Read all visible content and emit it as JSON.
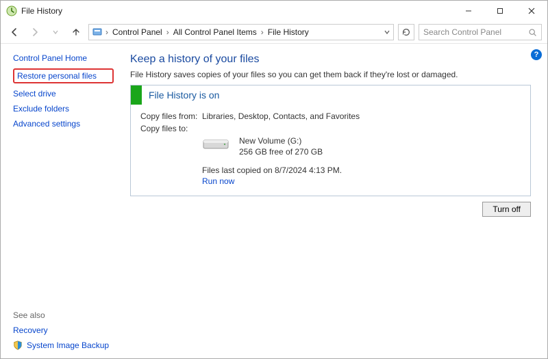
{
  "window": {
    "title": "File History"
  },
  "win_buttons": {
    "min": "—",
    "max": "▢",
    "close": "✕"
  },
  "breadcrumbs": [
    "Control Panel",
    "All Control Panel Items",
    "File History"
  ],
  "search": {
    "placeholder": "Search Control Panel"
  },
  "leftnav": {
    "home": "Control Panel Home",
    "restore": "Restore personal files",
    "select_drive": "Select drive",
    "exclude": "Exclude folders",
    "advanced": "Advanced settings"
  },
  "seealso": {
    "title": "See also",
    "recovery": "Recovery",
    "sib": "System Image Backup"
  },
  "main": {
    "title": "Keep a history of your files",
    "subtitle": "File History saves copies of your files so you can get them back if they're lost or damaged.",
    "box_title": "File History is on",
    "copy_from_label": "Copy files from:",
    "copy_from_value": "Libraries, Desktop, Contacts, and Favorites",
    "copy_to_label": "Copy files to:",
    "drive_name": "New Volume (G:)",
    "drive_space": "256 GB free of 270 GB",
    "last_copied": "Files last copied on 8/7/2024 4:13 PM.",
    "run_now": "Run now",
    "turn_off": "Turn off"
  },
  "help": "?"
}
